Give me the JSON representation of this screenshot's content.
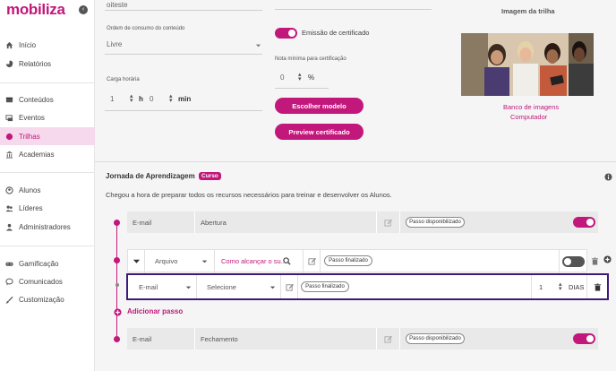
{
  "app": {
    "logo_text": "mobiliza"
  },
  "sidebar": {
    "items": [
      {
        "label": "Início",
        "icon": "home-icon"
      },
      {
        "label": "Relatórios",
        "icon": "pie-chart-icon"
      },
      {
        "label": "Conteúdos",
        "icon": "content-icon"
      },
      {
        "label": "Eventos",
        "icon": "events-icon"
      },
      {
        "label": "Trilhas",
        "icon": "trails-icon",
        "active": true
      },
      {
        "label": "Academias",
        "icon": "academy-icon"
      },
      {
        "label": "Alunos",
        "icon": "student-icon"
      },
      {
        "label": "Líderes",
        "icon": "leaders-icon"
      },
      {
        "label": "Administradores",
        "icon": "admin-icon"
      },
      {
        "label": "Gamificação",
        "icon": "gamepad-icon"
      },
      {
        "label": "Comunicados",
        "icon": "chat-icon"
      },
      {
        "label": "Customização",
        "icon": "brush-icon"
      }
    ]
  },
  "form": {
    "name_value": "oiteste",
    "order_label": "Ordem de consumo do conteúdo",
    "order_value": "Livre",
    "workload_label": "Carga horária",
    "hours_value": "1",
    "hours_unit": "h",
    "minutes_value": "0",
    "minutes_unit": "min",
    "certificate_label": "Emissão de certificado",
    "min_grade_label": "Nota mínima para certificação",
    "min_grade_value": "0",
    "min_grade_unit": "%",
    "choose_model_button": "Escolher modelo",
    "preview_button": "Preview certificado"
  },
  "image_panel": {
    "title": "Imagem da trilha",
    "bank_link": "Banco de imagens",
    "computer_link": "Computador"
  },
  "journey": {
    "title": "Jornada de Aprendizagem",
    "badge": "Curso",
    "description": "Chegou a hora de preparar todos os recursos necessários para treinar e desenvolver os Alunos.",
    "add_step_label": "Adicionar passo",
    "steps": [
      {
        "type": "E-mail",
        "name": "Abertura",
        "status": "Passo disponibilizado"
      },
      {
        "type": "Arquivo",
        "name": "Como alcançar o su...",
        "status": "Passo finalizado"
      },
      {
        "type": "E-mail",
        "select": "Selecione",
        "status": "Passo finalizado",
        "days_value": "1",
        "days_unit": "DIAS"
      },
      {
        "type": "E-mail",
        "name": "Fechamento",
        "status": "Passo disponibilizado"
      }
    ]
  },
  "colors": {
    "accent": "#c2177b",
    "highlight": "#3d1a7a"
  }
}
